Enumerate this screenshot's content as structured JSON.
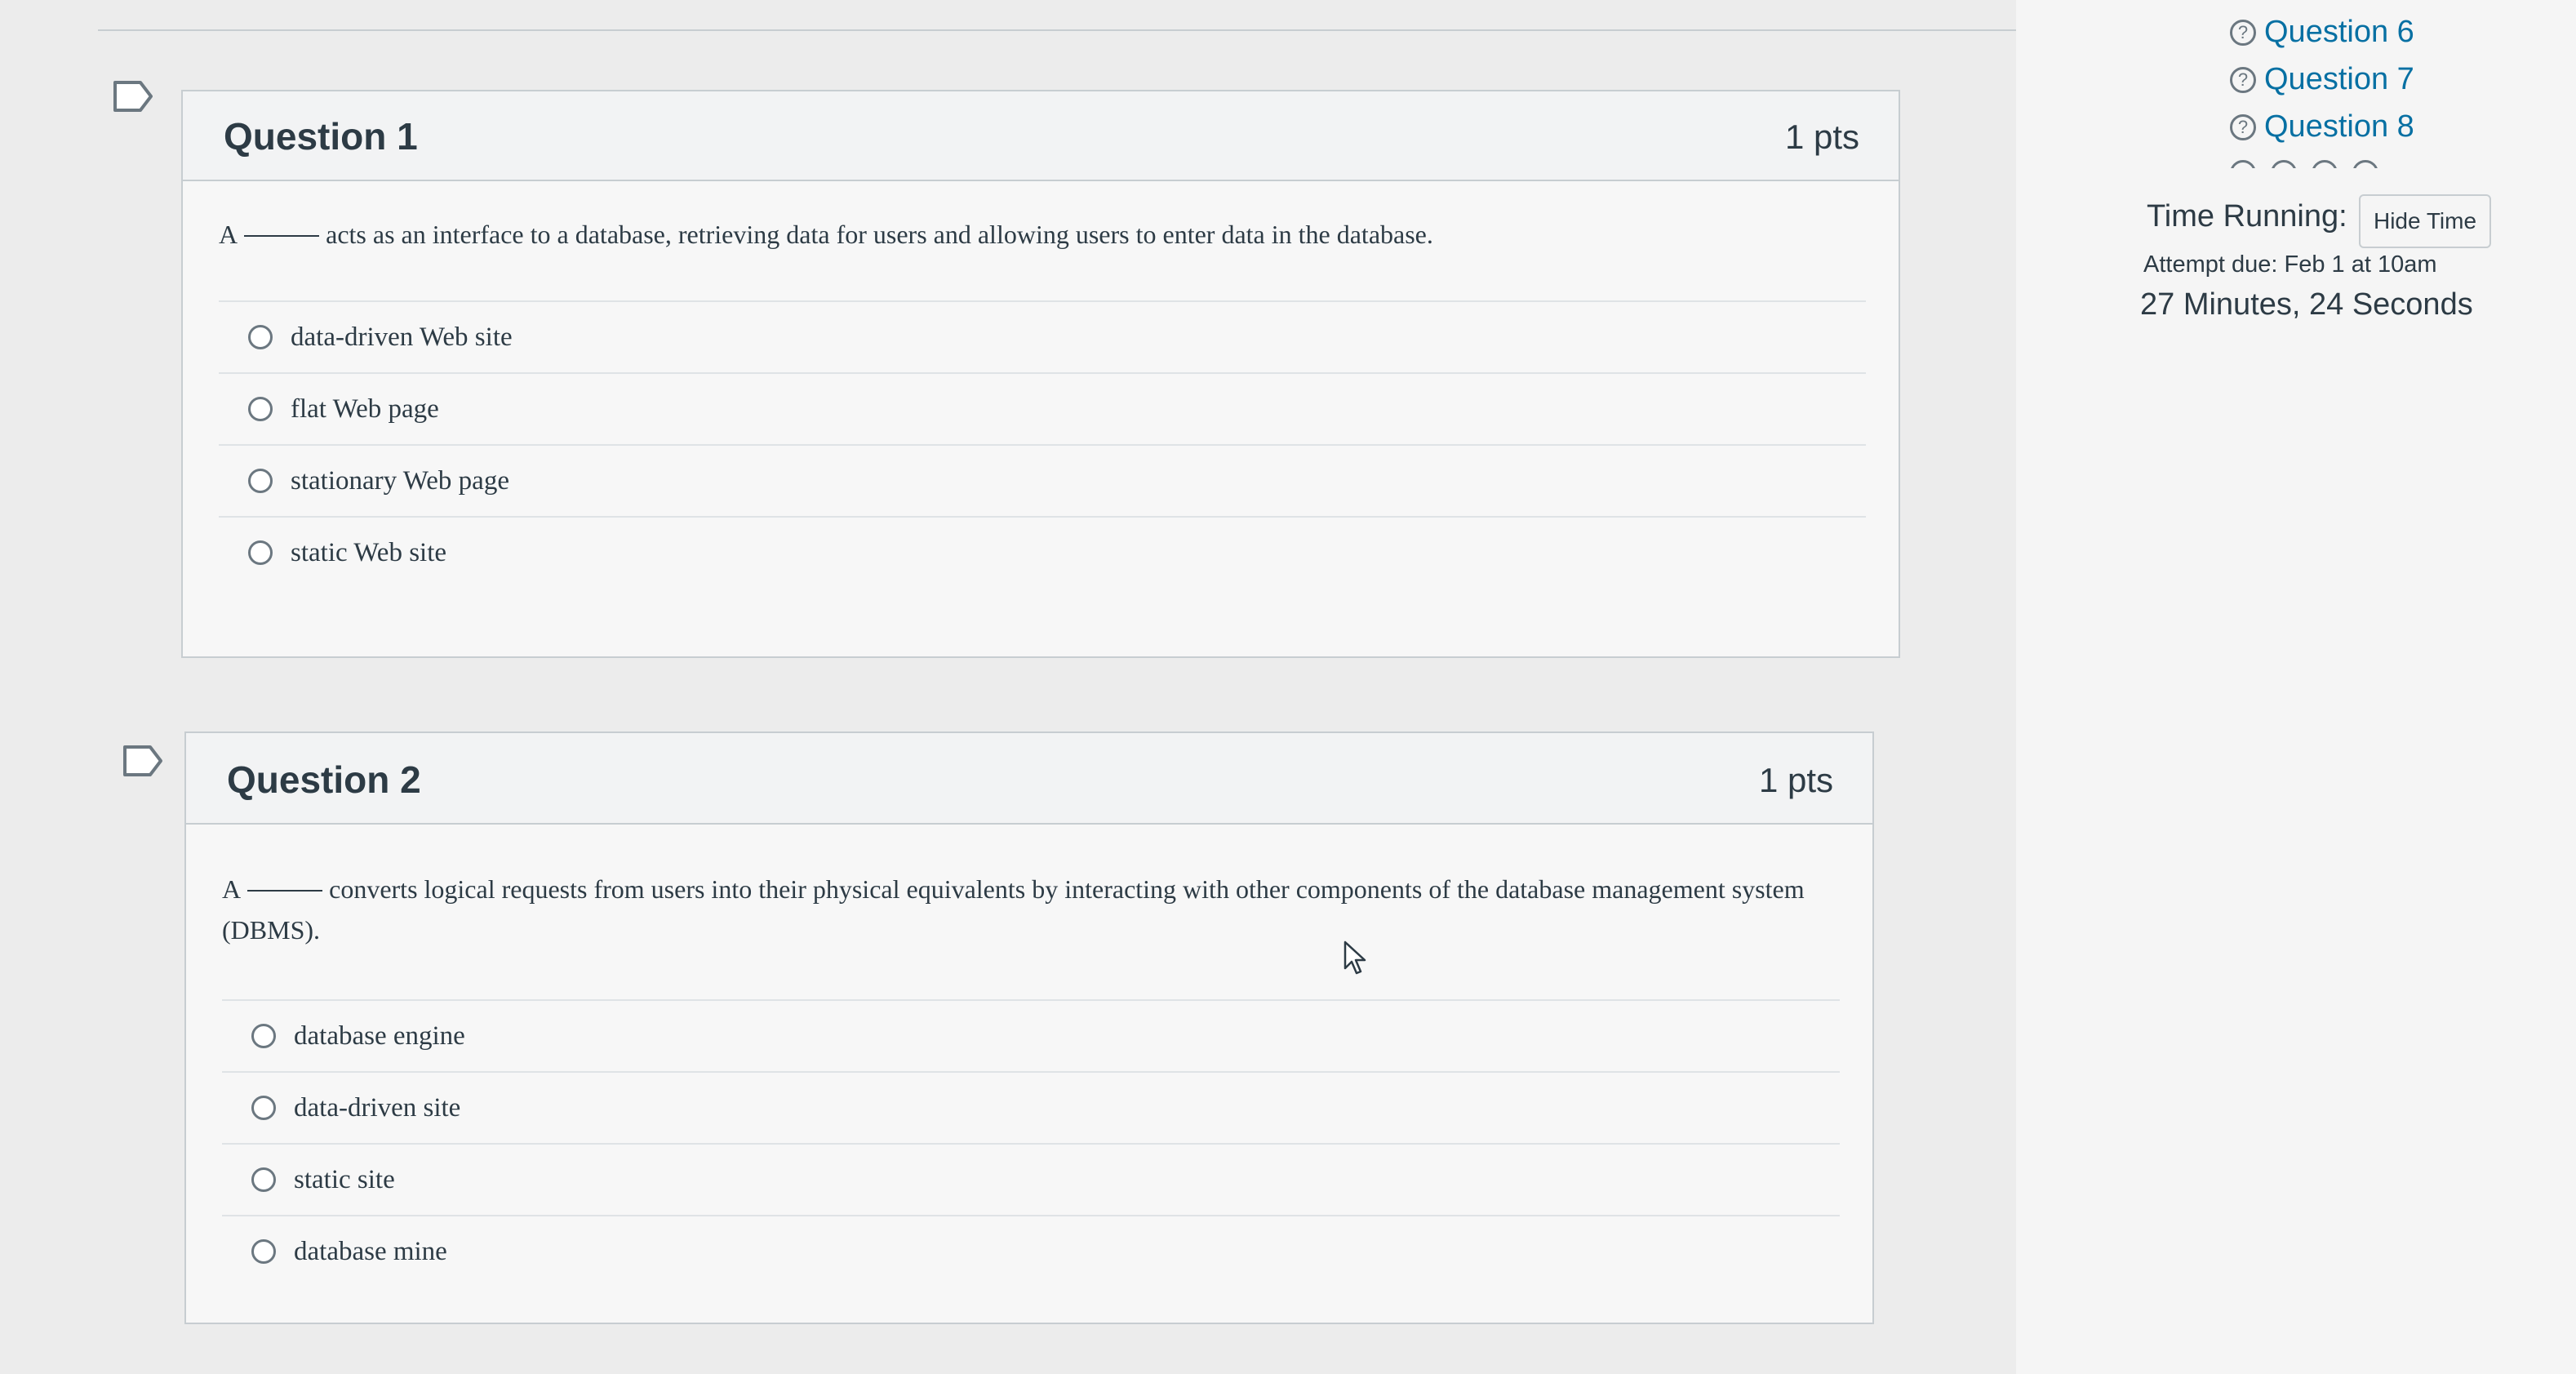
{
  "questions": [
    {
      "title": "Question 1",
      "points": "1 pts",
      "text_before": "A",
      "text_after": "acts as an interface to a database, retrieving data for users and allowing users to enter data in the database.",
      "answers": [
        "data-driven Web site",
        "flat Web page",
        "stationary Web page",
        "static Web site"
      ]
    },
    {
      "title": "Question 2",
      "points": "1 pts",
      "text_before": "A",
      "text_after": "converts logical requests from users into their physical equivalents by interacting with other components of the database management system (DBMS).",
      "answers": [
        "database engine",
        "data-driven site",
        "static site",
        "database mine"
      ]
    }
  ],
  "sidebar": {
    "question_links": [
      "Question 6",
      "Question 7",
      "Question 8"
    ],
    "help_glyph": "?",
    "help_icon": "question-circle-icon",
    "time_running_label": "Time Running:",
    "hide_time_label": "Hide Time",
    "attempt_due": "Attempt due: Feb 1 at 10am",
    "time_remaining": "27 Minutes, 24 Seconds"
  },
  "colors": {
    "link": "#0770a3",
    "text": "#2d3b45",
    "border": "#c7cdd1"
  }
}
